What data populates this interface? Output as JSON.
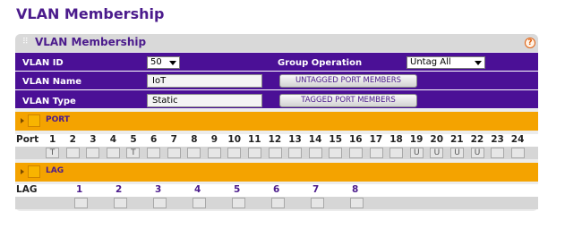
{
  "page": {
    "title": "VLAN Membership"
  },
  "panel": {
    "title": "VLAN Membership",
    "help_symbol": "?"
  },
  "form": {
    "vlan_id": {
      "label": "VLAN ID",
      "value": "50"
    },
    "group_operation": {
      "label": "Group Operation",
      "value": "Untag All"
    },
    "vlan_name": {
      "label": "VLAN Name",
      "value": "IoT"
    },
    "vlan_type": {
      "label": "VLAN Type",
      "value": "Static"
    },
    "untagged_button": "UNTAGGED PORT MEMBERS",
    "tagged_button": "TAGGED PORT MEMBERS"
  },
  "port_section": {
    "label": "PORT",
    "header_label": "Port",
    "ports": [
      "1",
      "2",
      "3",
      "4",
      "5",
      "6",
      "7",
      "8",
      "9",
      "10",
      "11",
      "12",
      "13",
      "14",
      "15",
      "16",
      "17",
      "18",
      "19",
      "20",
      "21",
      "22",
      "23",
      "24"
    ],
    "values": [
      "T",
      "",
      "",
      "",
      "T",
      "",
      "",
      "",
      "",
      "",
      "",
      "",
      "",
      "",
      "",
      "",
      "",
      "",
      "U",
      "U",
      "U",
      "U",
      "",
      ""
    ]
  },
  "lag_section": {
    "label": "LAG",
    "header_label": "LAG",
    "lags": [
      "1",
      "2",
      "3",
      "4",
      "5",
      "6",
      "7",
      "8"
    ],
    "values": [
      "",
      "",
      "",
      "",
      "",
      "",
      "",
      ""
    ]
  }
}
